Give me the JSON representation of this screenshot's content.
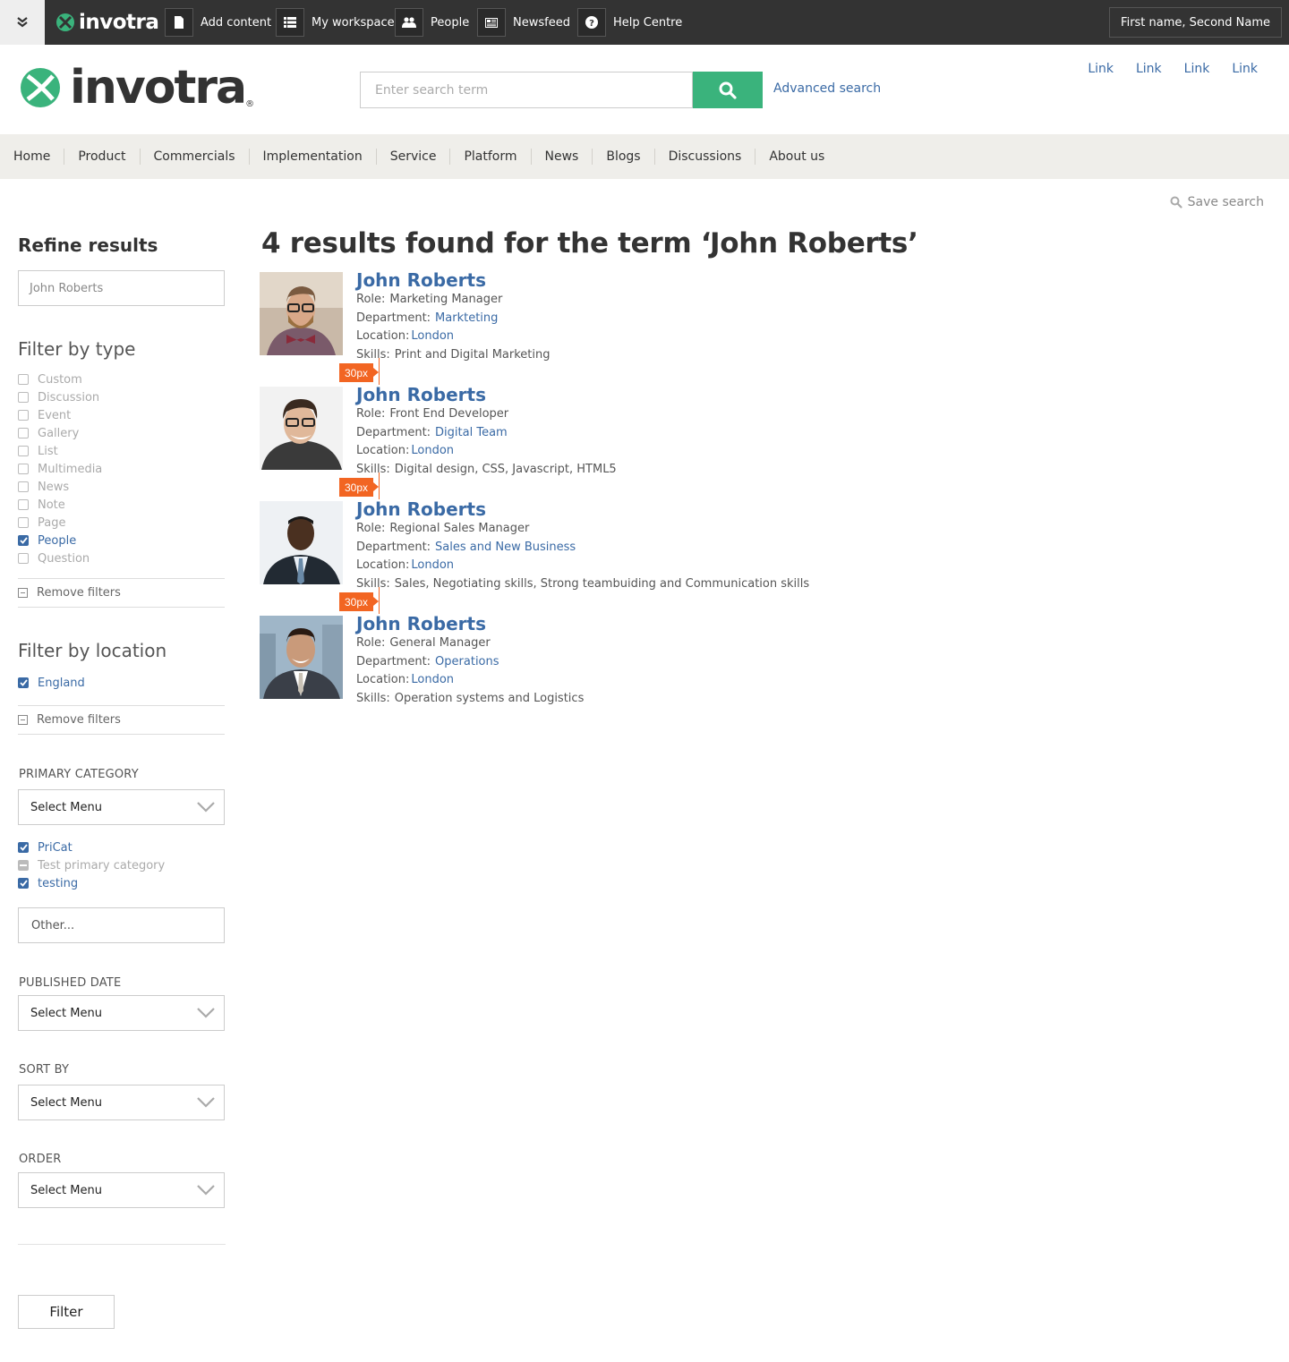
{
  "adminbar": {
    "brand": "invotra",
    "items": [
      {
        "label": "Add content",
        "icon": "document-icon"
      },
      {
        "label": "My workspace",
        "icon": "list-icon"
      },
      {
        "label": "People",
        "icon": "people-icon"
      },
      {
        "label": "Newsfeed",
        "icon": "newspaper-icon"
      },
      {
        "label": "Help Centre",
        "icon": "help-icon"
      }
    ],
    "user": "First name, Second Name"
  },
  "header": {
    "logo_text": "invotra",
    "logo_reg": "®",
    "search_placeholder": "Enter search term",
    "advanced_search": "Advanced search",
    "links": [
      "Link",
      "Link",
      "Link",
      "Link"
    ]
  },
  "nav": [
    "Home",
    "Product",
    "Commercials",
    "Implementation",
    "Service",
    "Platform",
    "News",
    "Blogs",
    "Discussions",
    "About us"
  ],
  "save_search": "Save search",
  "sidebar": {
    "refine_title": "Refine results",
    "refine_value": "John Roberts",
    "filter_type_title": "Filter by type",
    "types": [
      {
        "label": "Custom",
        "checked": false
      },
      {
        "label": "Discussion",
        "checked": false
      },
      {
        "label": "Event",
        "checked": false
      },
      {
        "label": "Gallery",
        "checked": false
      },
      {
        "label": "List",
        "checked": false
      },
      {
        "label": "Multimedia",
        "checked": false
      },
      {
        "label": "News",
        "checked": false
      },
      {
        "label": "Note",
        "checked": false
      },
      {
        "label": "Page",
        "checked": false
      },
      {
        "label": "People",
        "checked": true
      },
      {
        "label": "Question",
        "checked": false
      }
    ],
    "remove_filters": "Remove filters",
    "filter_location_title": "Filter by location",
    "locations": [
      {
        "label": "England",
        "checked": true
      }
    ],
    "primary_category_label": "PRIMARY CATEGORY",
    "primary_category_value": "Select Menu",
    "categories": [
      {
        "label": "PriCat",
        "state": "checked"
      },
      {
        "label": "Test primary category",
        "state": "partial"
      },
      {
        "label": "testing",
        "state": "checked"
      }
    ],
    "other_value": "Other...",
    "published_date_label": "PUBLISHED DATE",
    "published_date_value": "Select Menu",
    "sort_by_label": "SORT BY",
    "sort_by_value": "Select Menu",
    "order_label": "ORDER",
    "order_value": "Select Menu",
    "filter_button": "Filter"
  },
  "results_heading": "4 results found for the term ‘John Roberts’",
  "results": [
    {
      "name": "John Roberts",
      "role": "Marketing Manager",
      "department": "Markteting",
      "location": "London",
      "skills": "Print and Digital Marketing"
    },
    {
      "name": "John Roberts",
      "role": "Front End Developer",
      "department": "Digital Team",
      "location": "London",
      "skills": "Digital design, CSS, Javascript, HTML5"
    },
    {
      "name": "John Roberts",
      "role": "Regional Sales Manager",
      "department": "Sales and New Business",
      "location": "London",
      "skills": "Sales, Negotiating skills, Strong teambuiding and Communication skills"
    },
    {
      "name": "John Roberts",
      "role": "General Manager",
      "department": "Operations",
      "location": "London",
      "skills": "Operation systems and Logistics"
    }
  ],
  "result_labels": {
    "role": "Role:",
    "department": "Department:",
    "location": "Location:",
    "skills": "Skills:"
  },
  "spacing_marker": "30px",
  "colors": {
    "accent": "#3ab37c",
    "link": "#3a6aa5",
    "marker": "#f26522",
    "adminbar": "#333333"
  }
}
